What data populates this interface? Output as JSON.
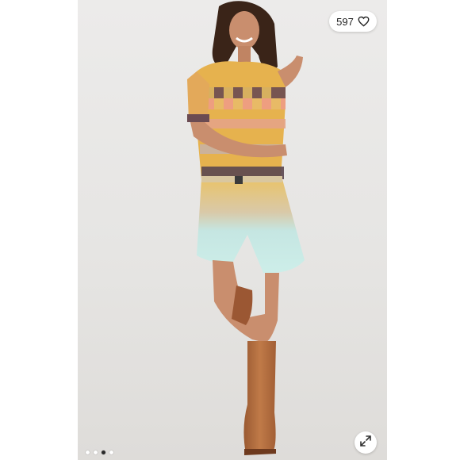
{
  "listing": {
    "like_count": "597",
    "like_icon": "heart-outline-icon",
    "expand_icon": "expand-arrows-icon",
    "carousel": {
      "total_slides": 4,
      "active_slide": 3
    }
  },
  "colors": {
    "accent_dot_active": "#2a2a2a",
    "accent_dot_inactive": "#ffffff",
    "backdrop": "#e6e5e3"
  }
}
